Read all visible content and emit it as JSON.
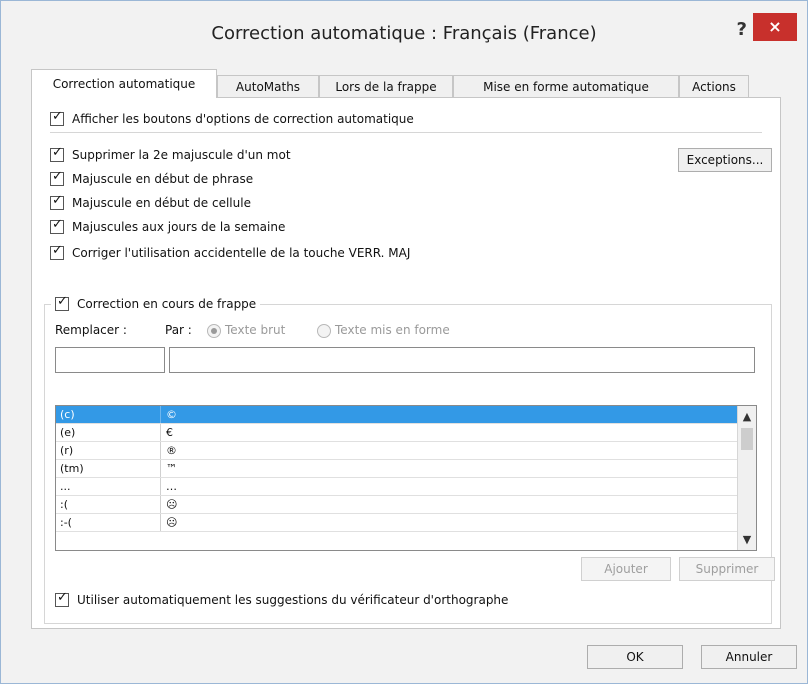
{
  "window": {
    "title": "Correction automatique : Français (France)",
    "help": "?",
    "close": "×"
  },
  "tabs": [
    {
      "label": "Correction automatique",
      "active": true
    },
    {
      "label": "AutoMaths"
    },
    {
      "label": "Lors de la frappe"
    },
    {
      "label": "Mise en forme automatique"
    },
    {
      "label": "Actions"
    }
  ],
  "options": {
    "show_buttons": {
      "label": "Afficher les boutons d'options de correction automatique",
      "checked": true
    },
    "second_capital": {
      "label": "Supprimer la 2e majuscule d'un mot",
      "checked": true
    },
    "sentence_start": {
      "label": "Majuscule en début de phrase",
      "checked": true
    },
    "cell_start": {
      "label": "Majuscule en début de cellule",
      "checked": true
    },
    "weekdays": {
      "label": "Majuscules aux jours de la semaine",
      "checked": true
    },
    "caps_lock": {
      "label": "Corriger l'utilisation accidentelle de la touche VERR. MAJ",
      "checked": true
    }
  },
  "exceptions_button": "Exceptions...",
  "replace_group": {
    "enabled_label": "Correction en cours de frappe",
    "checked": true,
    "replace_label": "Remplacer :",
    "with_label": "Par :",
    "plain_text": "Texte brut",
    "formatted_text": "Texte mis en forme",
    "replace_value": "",
    "with_value": ""
  },
  "entries": [
    {
      "from": "(c)",
      "to": "©"
    },
    {
      "from": "(e)",
      "to": "€"
    },
    {
      "from": "(r)",
      "to": "®"
    },
    {
      "from": "(tm)",
      "to": "™"
    },
    {
      "from": "...",
      "to": "…"
    },
    {
      "from": ":(",
      "to": "☹"
    },
    {
      "from": ":-(",
      "to": "☹"
    }
  ],
  "add_button": "Ajouter",
  "delete_button": "Supprimer",
  "spelling_suggestions": {
    "label": "Utiliser automatiquement les suggestions du vérificateur d'orthographe",
    "checked": true
  },
  "ok_button": "OK",
  "cancel_button": "Annuler",
  "colors": {
    "selection": "#3399e6",
    "close": "#c8302c"
  }
}
